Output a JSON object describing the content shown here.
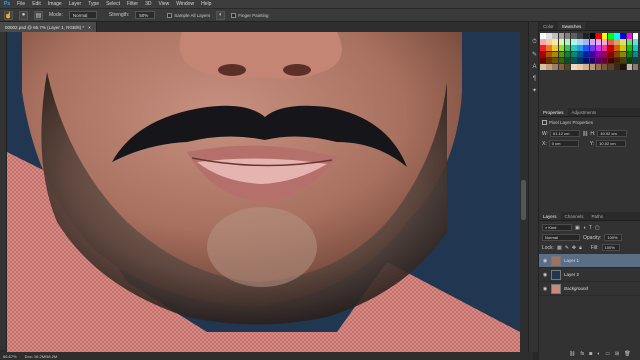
{
  "menu": [
    "File",
    "Edit",
    "Image",
    "Layer",
    "Type",
    "Select",
    "Filter",
    "3D",
    "View",
    "Window",
    "Help"
  ],
  "options": {
    "mode_label": "Mode:",
    "mode_value": "Normal",
    "strength_label": "Strength:",
    "strength_value": "50%",
    "sample_all_label": "Sample All Layers",
    "finger_painting_label": "Finger Painting"
  },
  "document": {
    "tab_title": "00002.psd @ 66.7% (Layer 1, RGB/8) *",
    "close_glyph": "×"
  },
  "status": {
    "zoom": "66.67%",
    "doc_info": "Doc: 16.2M/58.2M"
  },
  "swatches_panel": {
    "tabs": [
      "Color",
      "Swatches"
    ],
    "active_tab": "Swatches",
    "colors": [
      "#ffffff",
      "#e0e0e0",
      "#c0c0c0",
      "#a0a0a0",
      "#808080",
      "#606060",
      "#404040",
      "#202020",
      "#000000",
      "#ff0000",
      "#ffff00",
      "#00ff00",
      "#00ffff",
      "#0000ff",
      "#ff00ff",
      "#ffffff",
      "#f8a8a8",
      "#f8c8a8",
      "#f8e8a8",
      "#d8f8a8",
      "#a8f8b8",
      "#a8f8e8",
      "#a8d8f8",
      "#a8b0f8",
      "#c8a8f8",
      "#f0a8f8",
      "#f8a8d0",
      "#e06060",
      "#e0a060",
      "#e0e060",
      "#60e060",
      "#60e0e0",
      "#ee2222",
      "#ee7722",
      "#eecc22",
      "#99dd22",
      "#22cc55",
      "#22ccbb",
      "#2299ee",
      "#2255ee",
      "#7733ee",
      "#cc33ee",
      "#ee3399",
      "#cc0000",
      "#cc6600",
      "#cccc00",
      "#00cc00",
      "#00cccc",
      "#aa0000",
      "#aa5500",
      "#aa8800",
      "#559900",
      "#008833",
      "#008877",
      "#005599",
      "#002299",
      "#440099",
      "#880099",
      "#990055",
      "#880000",
      "#884400",
      "#888800",
      "#008800",
      "#008888",
      "#660000",
      "#663300",
      "#665500",
      "#336600",
      "#005522",
      "#005555",
      "#003366",
      "#001166",
      "#220066",
      "#550066",
      "#660033",
      "#440000",
      "#442200",
      "#444400",
      "#004400",
      "#004444",
      "#d8c0a0",
      "#c0a080",
      "#a08060",
      "#806040",
      "#604020",
      "#f0d8c0",
      "#e8c8a8",
      "#d0b090",
      "#b89878",
      "#987050",
      "#785838",
      "#5a4028",
      "#3c2818",
      "#1e140c",
      "#c8b4a0",
      "#8c7864"
    ]
  },
  "properties_panel": {
    "tabs": [
      "Properties",
      "Adjustments"
    ],
    "active_tab": "Properties",
    "header": "Pixel Layer Properties",
    "w_label": "W:",
    "w_value": "61.12 cm",
    "go_label": "GO",
    "x_label": "X:",
    "x_value": "0 cm",
    "h_label": "H:",
    "h_value": "40.02 cm",
    "y_label": "Y:",
    "y_value": "10.02 cm"
  },
  "layers_panel": {
    "tabs": [
      "Layers",
      "Channels",
      "Paths"
    ],
    "active_tab": "Layers",
    "kind_label": "Kind",
    "blend_mode": "Normal",
    "opacity_label": "Opacity:",
    "opacity_value": "100%",
    "lock_label": "Lock:",
    "fill_label": "Fill:",
    "fill_value": "100%",
    "layers": [
      {
        "name": "Layer 1",
        "selected": true,
        "thumb": "#a07060"
      },
      {
        "name": "Layer 2",
        "selected": false,
        "thumb": "#213650"
      },
      {
        "name": "Background",
        "selected": false,
        "thumb": "#c88a7a"
      }
    ],
    "eye_glyph": "◉",
    "footer_icons": [
      "link-icon",
      "fx-icon",
      "mask-icon",
      "adjustment-icon",
      "folder-icon",
      "new-layer-icon",
      "trash-icon"
    ]
  }
}
